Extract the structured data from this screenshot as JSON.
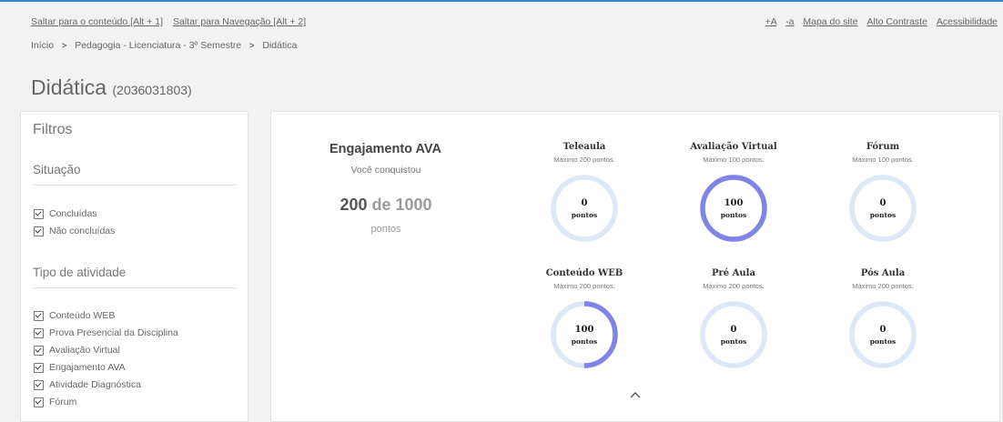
{
  "accessibility_bar": {
    "skip_content": "Saltar para o conteúdo [Alt + 1]",
    "skip_nav": "Saltar para Navegação [Alt + 2]",
    "font_increase": "+A",
    "font_decrease": "-a",
    "site_map": "Mapa do site",
    "high_contrast": "Alto Contraste",
    "accessibility": "Acessibilidade"
  },
  "breadcrumb": {
    "home": "Início",
    "course": "Pedagogia - Licenciatura - 3º Semestre",
    "current": "Didática"
  },
  "page": {
    "title": "Didática",
    "code": "(2036031803)"
  },
  "filters": {
    "title": "Filtros",
    "situation_title": "Situação",
    "situation": [
      {
        "label": "Concluídas",
        "checked": true
      },
      {
        "label": "Não concluídas",
        "checked": true
      }
    ],
    "activity_title": "Tipo de atividade",
    "activity": [
      {
        "label": "Conteúdo WEB",
        "checked": true
      },
      {
        "label": "Prova Presencial da Disciplina",
        "checked": true
      },
      {
        "label": "Avaliação Virtual",
        "checked": true
      },
      {
        "label": "Engajamento AVA",
        "checked": true
      },
      {
        "label": "Atividade Diagnóstica",
        "checked": true
      },
      {
        "label": "Fórum",
        "checked": true
      }
    ]
  },
  "engagement": {
    "title": "Engajamento AVA",
    "subtitle": "Você conquistou",
    "score": "200",
    "of_total": "de 1000",
    "unit": "pontos"
  },
  "colors": {
    "ring_track": "#dce8f7",
    "ring_fill": "#7f85e6",
    "accent": "#3a87c8"
  },
  "gauges": [
    {
      "title": "Teleaula",
      "max_label": "Máximo 200 pontos.",
      "value": "0",
      "unit": "pontos",
      "fraction": 0
    },
    {
      "title": "Avaliação Virtual",
      "max_label": "Máximo 100 pontos.",
      "value": "100",
      "unit": "pontos",
      "fraction": 1
    },
    {
      "title": "Fórum",
      "max_label": "Máximo 100 pontos.",
      "value": "0",
      "unit": "pontos",
      "fraction": 0
    },
    {
      "title": "Conteúdo WEB",
      "max_label": "Máximo 200 pontos.",
      "value": "100",
      "unit": "pontos",
      "fraction": 0.5
    },
    {
      "title": "Pré Aula",
      "max_label": "Máximo 200 pontos.",
      "value": "0",
      "unit": "pontos",
      "fraction": 0
    },
    {
      "title": "Pós Aula",
      "max_label": "Máximo 200 pontos.",
      "value": "0",
      "unit": "pontos",
      "fraction": 0
    }
  ],
  "icons": {
    "breadcrumb_separator": "chevron-right-icon",
    "collapse": "chevron-up-icon"
  }
}
